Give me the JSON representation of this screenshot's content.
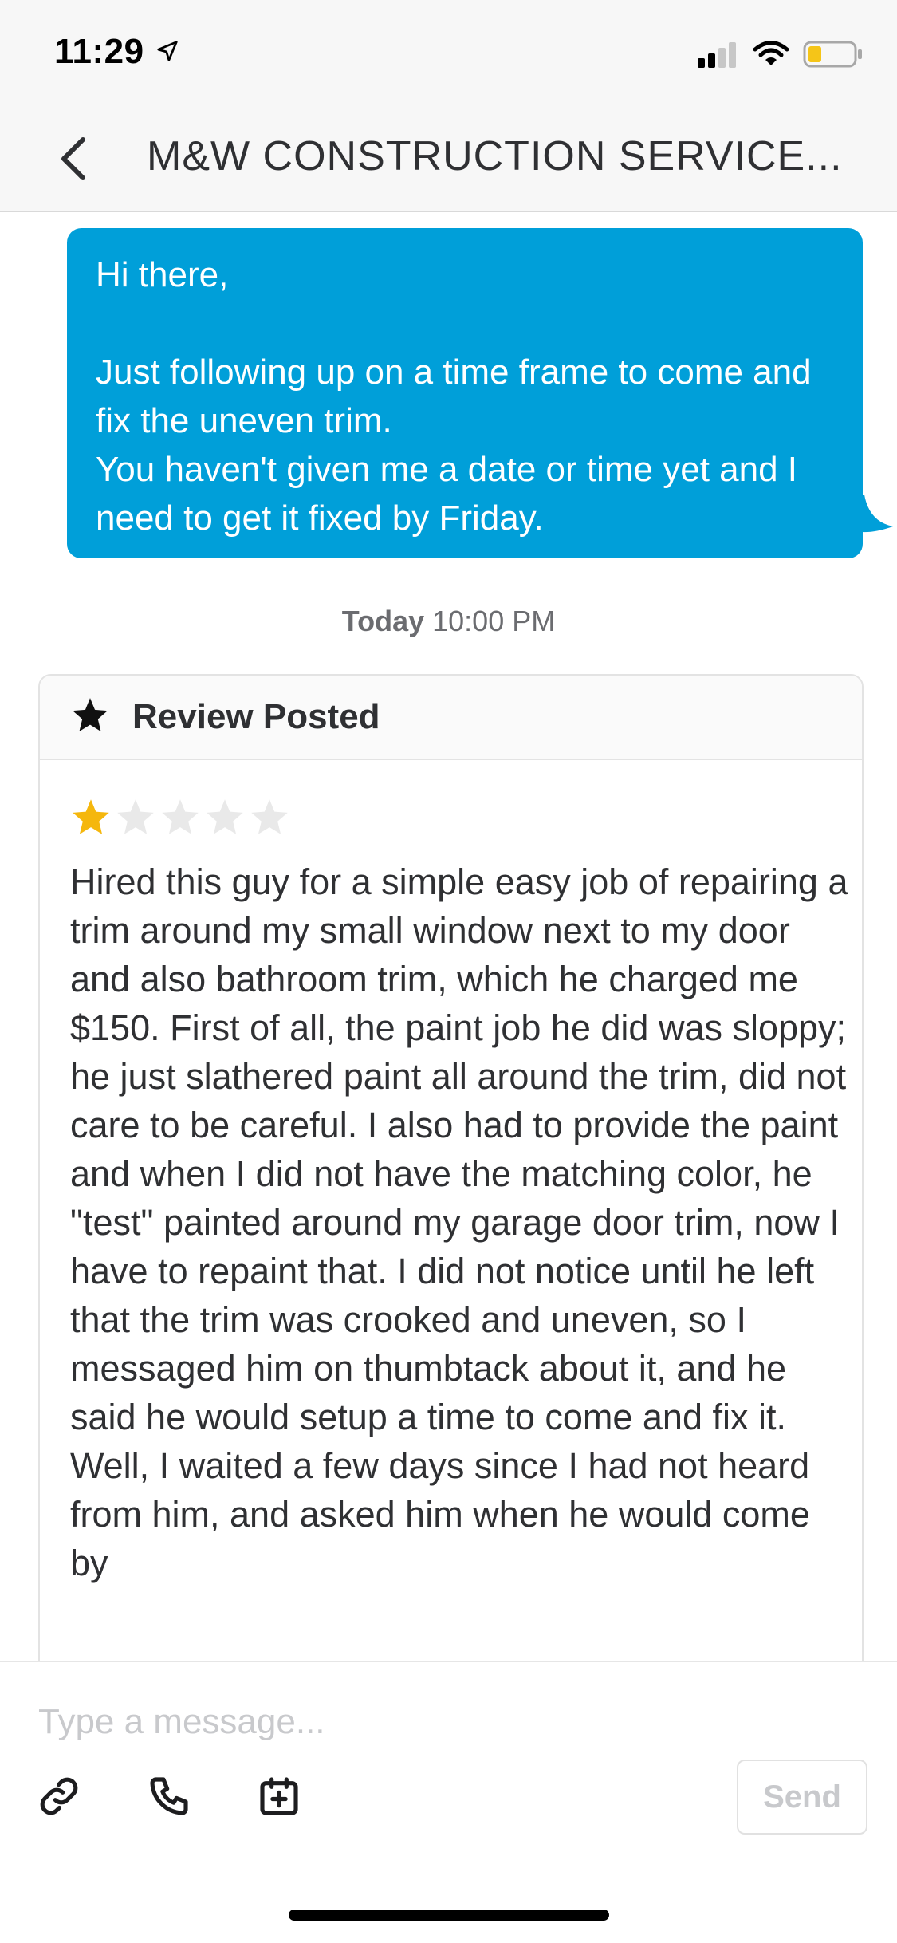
{
  "status_bar": {
    "time": "11:29",
    "icons": [
      "location-arrow-icon",
      "cellular-signal-icon",
      "wifi-icon",
      "battery-icon"
    ],
    "battery_color": "#f5c518"
  },
  "header": {
    "back_icon": "chevron-left-icon",
    "title": "M&W CONSTRUCTION SERVICE..."
  },
  "conversation": {
    "outgoing_message": "Hi there,\n\nJust following up on a time frame to come and fix the uneven trim.\nYou haven't given me a date or time yet and I need to get it fixed by Friday.",
    "timestamp_day": "Today",
    "timestamp_time": "10:00 PM",
    "review": {
      "icon": "star-icon",
      "title": "Review Posted",
      "rating": 1,
      "max_rating": 5,
      "text": "Hired this guy for a simple easy job of repairing a trim around my small window next to my door and also bathroom trim, which he charged me $150. First of all, the paint job he did was sloppy; he just slathered paint all around the trim, did not care to be careful. I also had to provide the paint and when I did not have the matching color, he \"test\" painted around my garage door trim, now I have to repaint that. I did not notice until he left that the trim was crooked and uneven, so I messaged him on thumbtack about it, and he said he would setup a time to come and fix it. Well, I waited a few days since I had not heard from him, and asked him when he would come by"
    }
  },
  "composer": {
    "placeholder": "Type a message...",
    "tools": [
      "link-icon",
      "phone-icon",
      "calendar-add-icon"
    ],
    "send_label": "Send"
  },
  "colors": {
    "accent": "#009fd9",
    "star_filled": "#f5b70d",
    "star_empty": "#e9e9e9"
  }
}
